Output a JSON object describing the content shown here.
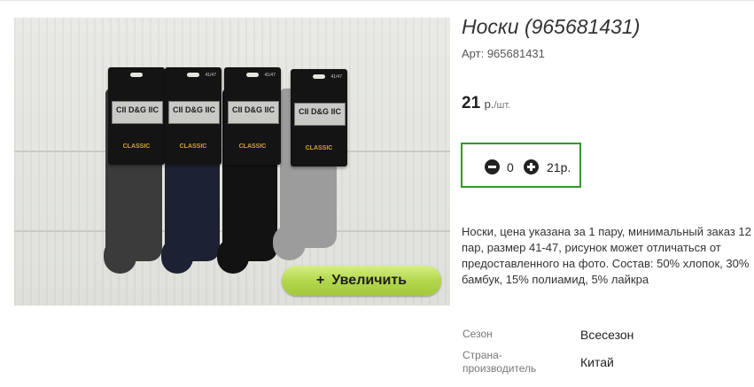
{
  "product": {
    "title": "Носки (965681431)",
    "sku_label": "Арт:",
    "sku": "965681431",
    "price": "21",
    "currency": "р.",
    "unit": "/шт.",
    "quantity": "0",
    "total": "21р.",
    "description": "Носки, цена указана за 1 пару, минимальный заказ 12 пар, размер 41-47, рисунок может отличаться от предоставленного на фото. Состав: 50% хлопок, 30% бамбук, 15% полиамид, 5% лайкра",
    "zoom_button": "Увеличить",
    "zoom_icon": "+"
  },
  "photo": {
    "brand": "CII D&G IIC",
    "tag": "CLASSIC",
    "size": "41/47"
  },
  "properties": [
    {
      "key": "Сезон",
      "value": "Всесезон"
    },
    {
      "key": "Страна-производитель",
      "value": "Китай"
    }
  ],
  "colors": {
    "accent_green": "#2f9a25",
    "zoom_button": "#b3d74c"
  }
}
